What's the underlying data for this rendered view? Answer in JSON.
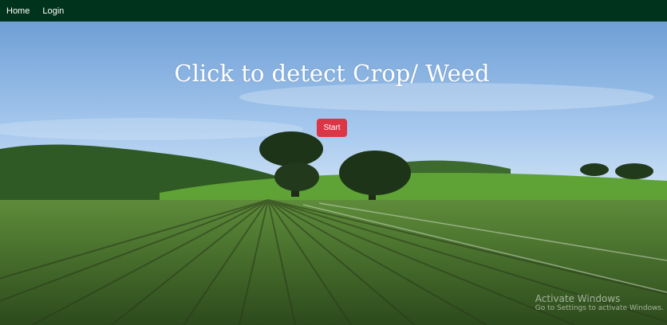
{
  "nav": {
    "items": [
      {
        "label": "Home"
      },
      {
        "label": "Login"
      }
    ]
  },
  "hero": {
    "title": "Click to detect Crop/ Weed",
    "start_label": "Start"
  },
  "watermark": {
    "title": "Activate Windows",
    "subtitle": "Go to Settings to activate Windows."
  },
  "colors": {
    "navbar": "#00331c",
    "start_button": "#dc3545",
    "sky": "#8fb9e8",
    "field": "#3f6b28"
  }
}
